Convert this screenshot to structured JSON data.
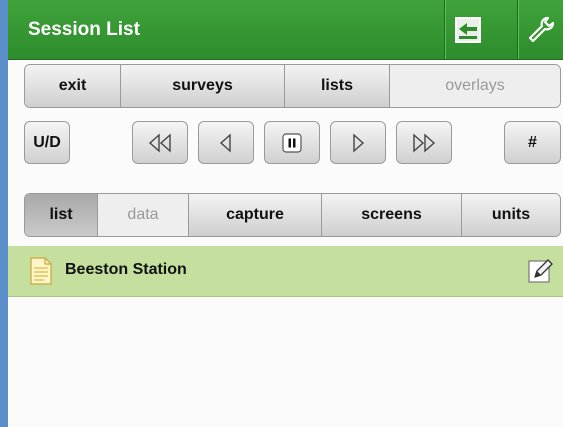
{
  "header": {
    "title": "Session List",
    "back_icon": "exit-arrow-icon",
    "settings_icon": "wrench-icon",
    "background": "#2e8c2c"
  },
  "nav_tabs": [
    {
      "label": "exit",
      "state": "normal"
    },
    {
      "label": "surveys",
      "state": "normal"
    },
    {
      "label": "lists",
      "state": "normal"
    },
    {
      "label": "overlays",
      "state": "disabled"
    }
  ],
  "playback": {
    "ud_label": "U/D",
    "hash_label": "#",
    "controls": [
      "rewind-icon",
      "step-back-icon",
      "pause-icon",
      "step-forward-icon",
      "fast-forward-icon"
    ]
  },
  "view_tabs": [
    {
      "label": "list",
      "state": "selected"
    },
    {
      "label": "data",
      "state": "disabled"
    },
    {
      "label": "capture",
      "state": "normal"
    },
    {
      "label": "screens",
      "state": "normal"
    },
    {
      "label": "units",
      "state": "normal"
    }
  ],
  "sessions": [
    {
      "name": "Beeston Station",
      "icon": "document-icon",
      "action_icon": "edit-icon"
    }
  ],
  "colors": {
    "header_green": "#2e8c2c",
    "row_highlight": "#c4df9e",
    "left_strip": "#5b8fc9"
  }
}
